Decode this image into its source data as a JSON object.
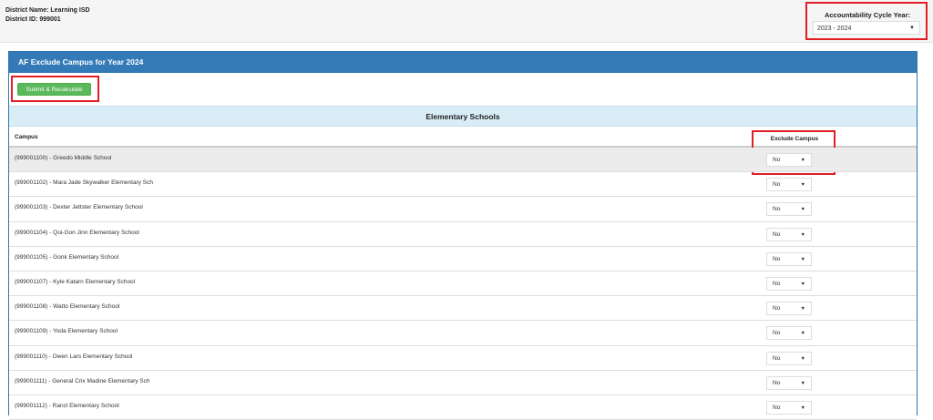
{
  "header": {
    "district_name": "District Name: Learning ISD",
    "district_id": "District ID: 999001",
    "cycle_label": "Accountability Cycle Year:",
    "cycle_value": "2023 - 2024"
  },
  "panel": {
    "title": "AF Exclude Campus for Year 2024",
    "submit_label": "Submit & Recalculate",
    "section_title": "Elementary Schools",
    "col_campus": "Campus",
    "col_exclude": "Exclude Campus"
  },
  "rows": [
    {
      "campus": "(999001100) - Greedo Middle School",
      "exclude": "No"
    },
    {
      "campus": "(999001102) - Mara Jade Skywalker Elementary Sch",
      "exclude": "No"
    },
    {
      "campus": "(999001103) - Dexter Jettster Elementary School",
      "exclude": "No"
    },
    {
      "campus": "(999001104) - Qui-Gon Jinn Elementary School",
      "exclude": "No"
    },
    {
      "campus": "(999001105) - Gonk Elementary School",
      "exclude": "No"
    },
    {
      "campus": "(999001107) - Kyle Katarn Elementary School",
      "exclude": "No"
    },
    {
      "campus": "(999001108) - Watto Elementary School",
      "exclude": "No"
    },
    {
      "campus": "(999001109) - Yoda Elementary School",
      "exclude": "No"
    },
    {
      "campus": "(999001110) - Owen Lars Elementary School",
      "exclude": "No"
    },
    {
      "campus": "(999001111) - General Crix Madine Elementary Sch",
      "exclude": "No"
    },
    {
      "campus": "(999001112) - Rancl Elementary School",
      "exclude": "No"
    }
  ],
  "icons": {
    "dropdown_caret": "caret-down-icon"
  },
  "colors": {
    "panel_header": "#337ab7",
    "submit_button": "#5cb85c",
    "section_header": "#d9edf7",
    "highlight": "#e11d25"
  }
}
